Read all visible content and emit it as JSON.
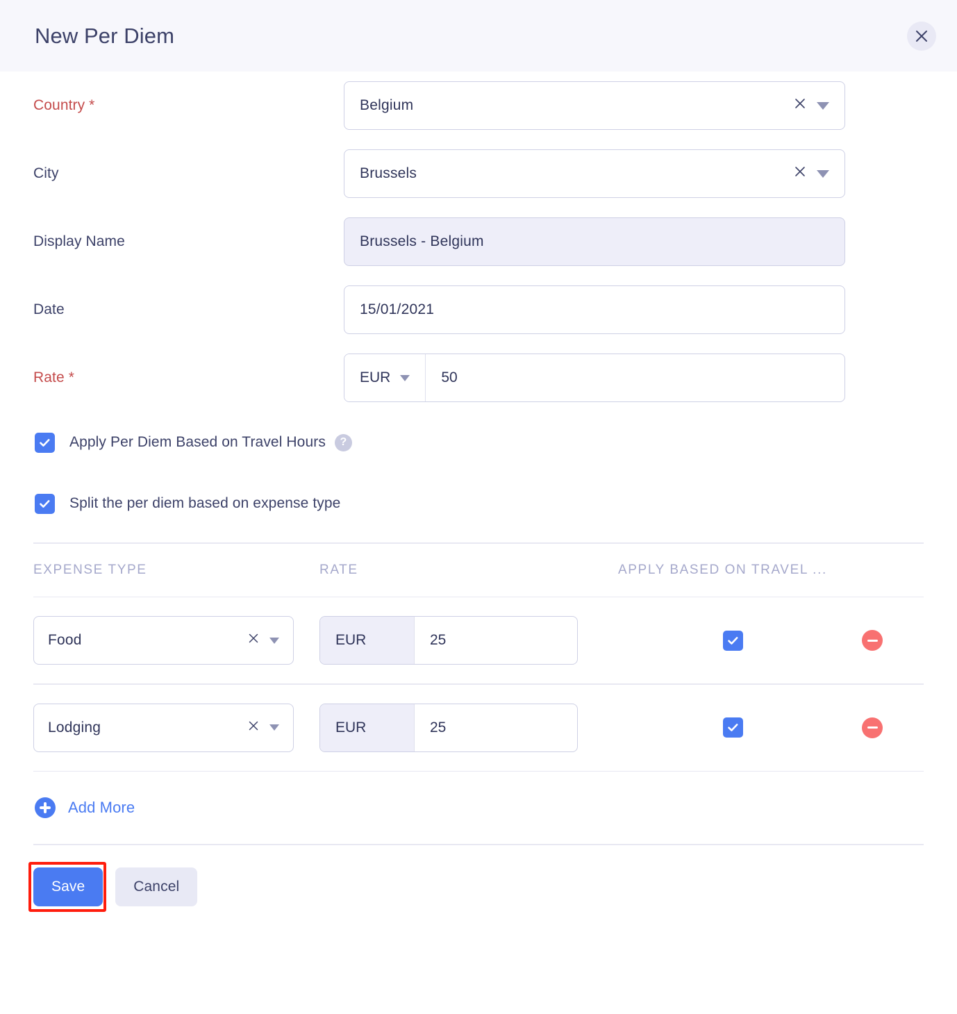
{
  "header": {
    "title": "New Per Diem",
    "close_icon": "close-icon"
  },
  "form": {
    "country": {
      "label": "Country *",
      "value": "Belgium",
      "clear_icon": "clear-icon",
      "caret_icon": "chevron-down-icon"
    },
    "city": {
      "label": "City",
      "value": "Brussels",
      "clear_icon": "clear-icon",
      "caret_icon": "chevron-down-icon"
    },
    "display_name": {
      "label": "Display Name",
      "value": "Brussels - Belgium"
    },
    "date": {
      "label": "Date",
      "value": "15/01/2021"
    },
    "rate": {
      "label": "Rate *",
      "currency": "EUR",
      "amount": "50"
    }
  },
  "options": {
    "apply_travel_hours": {
      "label": "Apply Per Diem Based on Travel Hours",
      "checked": true,
      "help_icon": "?"
    },
    "split_expense_type": {
      "label": "Split the per diem based on expense type",
      "checked": true
    }
  },
  "split_table": {
    "columns": {
      "expense_type": "EXPENSE TYPE",
      "rate": "RATE",
      "apply": "APPLY BASED ON TRAVEL ..."
    },
    "rows": [
      {
        "expense_type": "Food",
        "currency": "EUR",
        "amount": "25",
        "apply_checked": true
      },
      {
        "expense_type": "Lodging",
        "currency": "EUR",
        "amount": "25",
        "apply_checked": true
      }
    ],
    "add_more_label": "Add More"
  },
  "footer": {
    "save_label": "Save",
    "cancel_label": "Cancel"
  },
  "colors": {
    "accent_blue": "#4a7bf2",
    "required_red": "#c44b4b",
    "delete_red": "#f87171",
    "annotation_red": "#ff1d0d",
    "header_bg": "#f7f7fc",
    "disabled_bg": "#eeeef9",
    "text_dark": "#3c4168",
    "muted_lavender": "#a5a8cb"
  }
}
